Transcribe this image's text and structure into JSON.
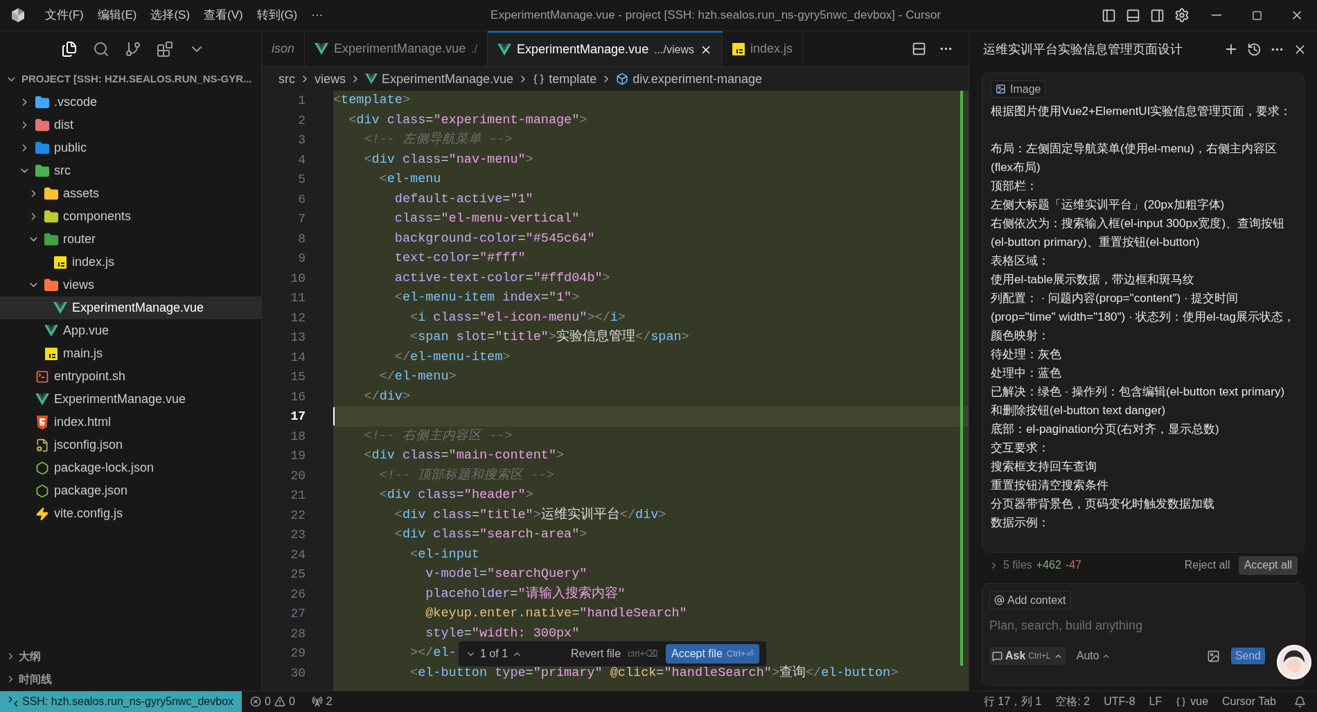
{
  "titlebar": {
    "menu": [
      "文件(F)",
      "编辑(E)",
      "选择(S)",
      "查看(V)",
      "转到(G)",
      "···"
    ],
    "title": "ExperimentManage.vue - project [SSH: hzh.sealos.run_ns-gyry5nwc_devbox] - Cursor"
  },
  "activity": [
    {
      "kind": "files",
      "selected": true
    },
    {
      "kind": "search",
      "selected": false
    },
    {
      "kind": "git",
      "selected": false
    },
    {
      "kind": "extensions",
      "selected": false
    },
    {
      "kind": "more",
      "selected": false
    }
  ],
  "explorer": {
    "title": "PROJECT [SSH: HZH.SEALOS.RUN_NS-GYR...",
    "tree": [
      {
        "label": ".vscode",
        "kind": "folder",
        "color": "#42a5f5",
        "expanded": false,
        "selected": false
      },
      {
        "label": "dist",
        "kind": "folder",
        "color": "#e57373",
        "expanded": false,
        "selected": false
      },
      {
        "label": "public",
        "kind": "folder",
        "color": "#1e88e5",
        "expanded": false,
        "selected": false
      },
      {
        "label": "src",
        "kind": "folder",
        "color": "#4caf50",
        "expanded": true,
        "selected": false,
        "children": [
          {
            "label": "assets",
            "kind": "folder",
            "color": "#fbc02d",
            "expanded": false,
            "selected": false
          },
          {
            "label": "components",
            "kind": "folder",
            "color": "#c0ca33",
            "expanded": false,
            "selected": false
          },
          {
            "label": "router",
            "kind": "folder",
            "color": "#43a047",
            "expanded": true,
            "selected": false,
            "children": [
              {
                "label": "index.js",
                "kind": "js",
                "selected": false
              }
            ]
          },
          {
            "label": "views",
            "kind": "folder",
            "color": "#ff7043",
            "expanded": true,
            "selected": false,
            "children": [
              {
                "label": "ExperimentManage.vue",
                "kind": "vue",
                "selected": true
              }
            ]
          },
          {
            "label": "App.vue",
            "kind": "vue",
            "selected": false
          },
          {
            "label": "main.js",
            "kind": "js",
            "selected": false
          }
        ]
      },
      {
        "label": "entrypoint.sh",
        "kind": "shell",
        "selected": false
      },
      {
        "label": "ExperimentManage.vue",
        "kind": "vue",
        "selected": false
      },
      {
        "label": "index.html",
        "kind": "html",
        "selected": false
      },
      {
        "label": "jsconfig.json",
        "kind": "jsconfig",
        "selected": false
      },
      {
        "label": "package-lock.json",
        "kind": "node",
        "selected": false
      },
      {
        "label": "package.json",
        "kind": "node",
        "selected": false
      },
      {
        "label": "vite.config.js",
        "kind": "vite",
        "selected": false
      }
    ],
    "sections": [
      {
        "label": "大纲",
        "expanded": false
      },
      {
        "label": "时间线",
        "expanded": false
      }
    ]
  },
  "tabs": [
    {
      "label": "ison",
      "kind": "plain",
      "preview": true,
      "selected": false
    },
    {
      "label": "ExperimentManage.vue",
      "detail": "./",
      "kind": "vue",
      "preview": false,
      "selected": false
    },
    {
      "label": "ExperimentManage.vue",
      "detail": ".../views",
      "kind": "vue",
      "preview": false,
      "selected": true
    },
    {
      "label": "index.js",
      "kind": "js",
      "preview": false,
      "selected": false
    }
  ],
  "breadcrumb": [
    {
      "label": "src",
      "kind": "plain"
    },
    {
      "label": "views",
      "kind": "plain"
    },
    {
      "label": "ExperimentManage.vue",
      "kind": "vue"
    },
    {
      "label": "template",
      "kind": "braces"
    },
    {
      "label": "div.experiment-manage",
      "kind": "element"
    }
  ],
  "code": [
    {
      "n": "1",
      "code": "<template>",
      "current": false
    },
    {
      "n": "2",
      "code": "  <div class=\"experiment-manage\">",
      "current": false
    },
    {
      "n": "3",
      "code": "    <!-- 左侧导航菜单 -->",
      "current": false
    },
    {
      "n": "4",
      "code": "    <div class=\"nav-menu\">",
      "current": false
    },
    {
      "n": "5",
      "code": "      <el-menu",
      "current": false
    },
    {
      "n": "6",
      "code": "        default-active=\"1\"",
      "current": false
    },
    {
      "n": "7",
      "code": "        class=\"el-menu-vertical\"",
      "current": false
    },
    {
      "n": "8",
      "code": "        background-color=\"#545c64\"",
      "current": false
    },
    {
      "n": "9",
      "code": "        text-color=\"#fff\"",
      "current": false
    },
    {
      "n": "10",
      "code": "        active-text-color=\"#ffd04b\">",
      "current": false
    },
    {
      "n": "11",
      "code": "        <el-menu-item index=\"1\">",
      "current": false
    },
    {
      "n": "12",
      "code": "          <i class=\"el-icon-menu\"></i>",
      "current": false
    },
    {
      "n": "13",
      "code": "          <span slot=\"title\">实验信息管理</span>",
      "current": false
    },
    {
      "n": "14",
      "code": "        </el-menu-item>",
      "current": false
    },
    {
      "n": "15",
      "code": "      </el-menu>",
      "current": false
    },
    {
      "n": "16",
      "code": "    </div>",
      "current": false
    },
    {
      "n": "17",
      "current": true
    },
    {
      "n": "18",
      "code": "    <!-- 右侧主内容区 -->",
      "current": false
    },
    {
      "n": "19",
      "code": "    <div class=\"main-content\">",
      "current": false
    },
    {
      "n": "20",
      "code": "      <!-- 顶部标题和搜索区 -->",
      "current": false
    },
    {
      "n": "21",
      "code": "      <div class=\"header\">",
      "current": false
    },
    {
      "n": "22",
      "code": "        <div class=\"title\">运维实训平台</div>",
      "current": false
    },
    {
      "n": "23",
      "code": "        <div class=\"search-area\">",
      "current": false
    },
    {
      "n": "24",
      "code": "          <el-input",
      "current": false
    },
    {
      "n": "25",
      "code": "            v-model=\"searchQuery\"",
      "current": false
    },
    {
      "n": "26",
      "code": "            placeholder=\"请输入搜索内容\"",
      "current": false
    },
    {
      "n": "27",
      "code": "            @keyup.enter.native=\"handleSearch\"",
      "current": false
    },
    {
      "n": "28",
      "code": "            style=\"width: 300px\"",
      "current": false
    },
    {
      "n": "29",
      "code": "          ></el-",
      "current": false
    },
    {
      "n": "30",
      "code": "          <el-button type=\"primary\" @click=\"handleSearch\">查询</el-button>",
      "current": false
    }
  ],
  "review_bar": {
    "counter": "1 of 1",
    "revert": "Revert file",
    "revert_key": "ctrl+⌫",
    "accept": "Accept file",
    "accept_key": "Ctrl+⏎"
  },
  "chat": {
    "title": "运维实训平台实验信息管理页面设计",
    "attachment": "Image",
    "intro": "根据图片使用Vue2+ElementUI实验信息管理页面，要求：",
    "lines": [
      "布局：左侧固定导航菜单(使用el-menu)，右侧主内容区(flex布局)",
      "顶部栏：",
      "左侧大标题「运维实训平台」(20px加粗字体)",
      "右侧依次为：搜索输入框(el-input 300px宽度)、查询按钮(el-button primary)、重置按钮(el-button)",
      "表格区域：",
      "使用el-table展示数据，带边框和斑马纹",
      "列配置： · 问题内容(prop=\"content\") · 提交时间(prop=\"time\" width=\"180\") · 状态列：使用el-tag展示状态，颜色映射：",
      "待处理：灰色",
      "处理中：蓝色",
      "已解决：绿色 · 操作列：包含编辑(el-button text primary)和删除按钮(el-button text danger)",
      "底部：el-pagination分页(右对齐，显示总数)",
      "交互要求：",
      "搜索框支持回车查询",
      "重置按钮清空搜索条件",
      "分页器带背景色，页码变化时触发数据加载",
      "数据示例："
    ],
    "files": "5 files",
    "added": "+462",
    "removed": "-47",
    "reject": "Reject all",
    "accept": "Accept all",
    "context": "Add context",
    "placeholder": "Plan, search, build anything",
    "mode": "Ask",
    "mode_key": "Ctrl+L",
    "model": "Auto",
    "send": "Send"
  },
  "status": {
    "remote": "SSH: hzh.sealos.run_ns-gyry5nwc_devbox",
    "errors": "0",
    "warnings": "0",
    "ports": "2",
    "position": "行 17，列 1",
    "indent": "空格: 2",
    "encoding": "UTF-8",
    "eol": "LF",
    "language": "vue",
    "cursor_tab": "Cursor Tab"
  }
}
